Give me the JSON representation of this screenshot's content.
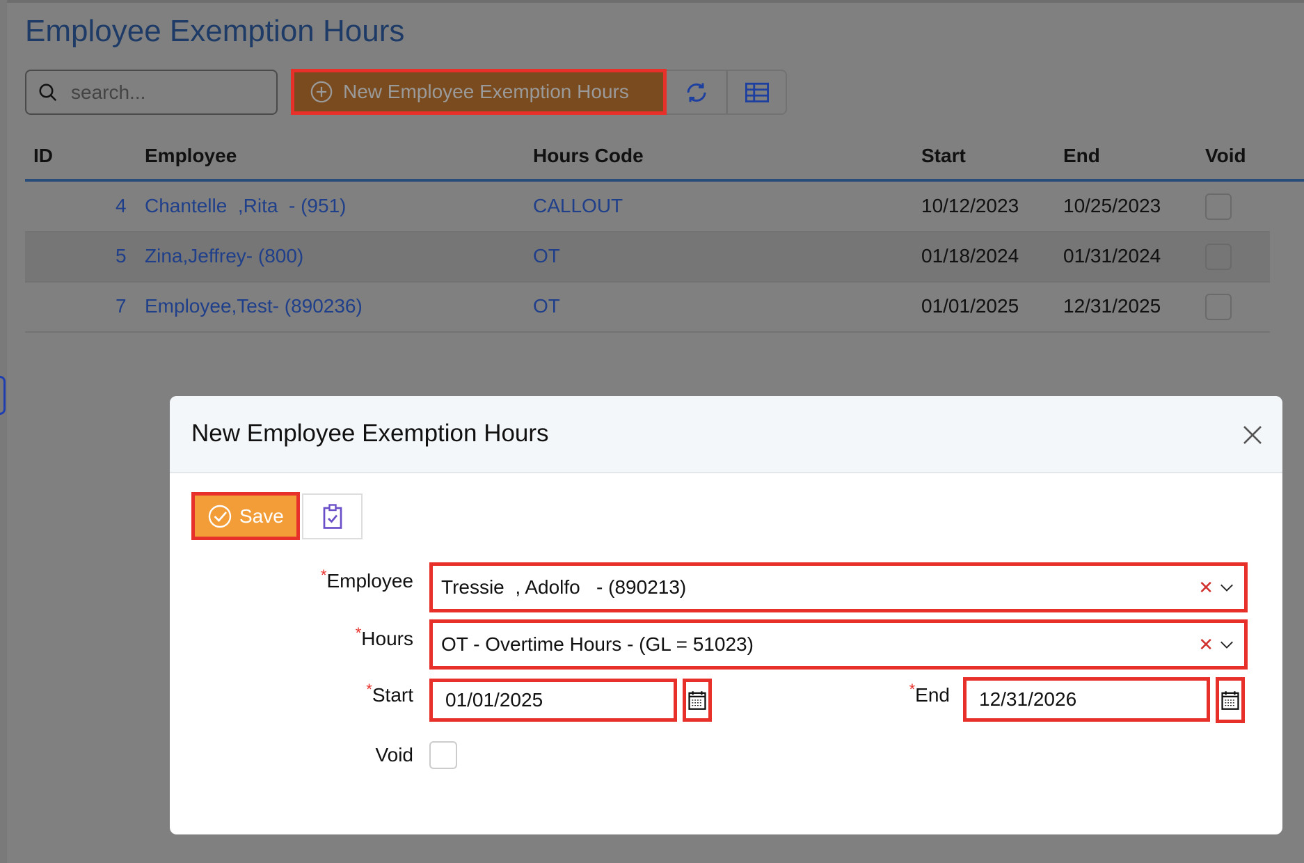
{
  "page": {
    "title": "Employee Exemption Hours"
  },
  "toolbar": {
    "search_placeholder": "search...",
    "new_label": "New Employee Exemption Hours"
  },
  "table": {
    "headers": [
      "ID",
      "Employee",
      "Hours Code",
      "Start",
      "End",
      "Void"
    ],
    "rows": [
      {
        "id": "4",
        "employee": "Chantelle  ,Rita  - (951)",
        "code": "CALLOUT",
        "start": "10/12/2023",
        "end": "10/25/2023",
        "void": false
      },
      {
        "id": "5",
        "employee": "Zina,Jeffrey- (800)",
        "code": "OT",
        "start": "01/18/2024",
        "end": "01/31/2024",
        "void": false
      },
      {
        "id": "7",
        "employee": "Employee,Test- (890236)",
        "code": "OT",
        "start": "01/01/2025",
        "end": "12/31/2025",
        "void": false
      }
    ]
  },
  "modal": {
    "title": "New Employee Exemption Hours",
    "save_label": "Save",
    "fields": {
      "employee_label": "Employee",
      "employee_value": "Tressie  , Adolfo   - (890213)",
      "hours_label": "Hours",
      "hours_value": "OT - Overtime Hours - (GL = 51023)",
      "start_label": "Start",
      "start_value": "01/01/2025",
      "end_label": "End",
      "end_value": "12/31/2026",
      "void_label": "Void",
      "required_mark": "*"
    }
  },
  "colors": {
    "accent": "#f29d38",
    "highlight": "#e8302a",
    "link": "#1f3f8a"
  }
}
